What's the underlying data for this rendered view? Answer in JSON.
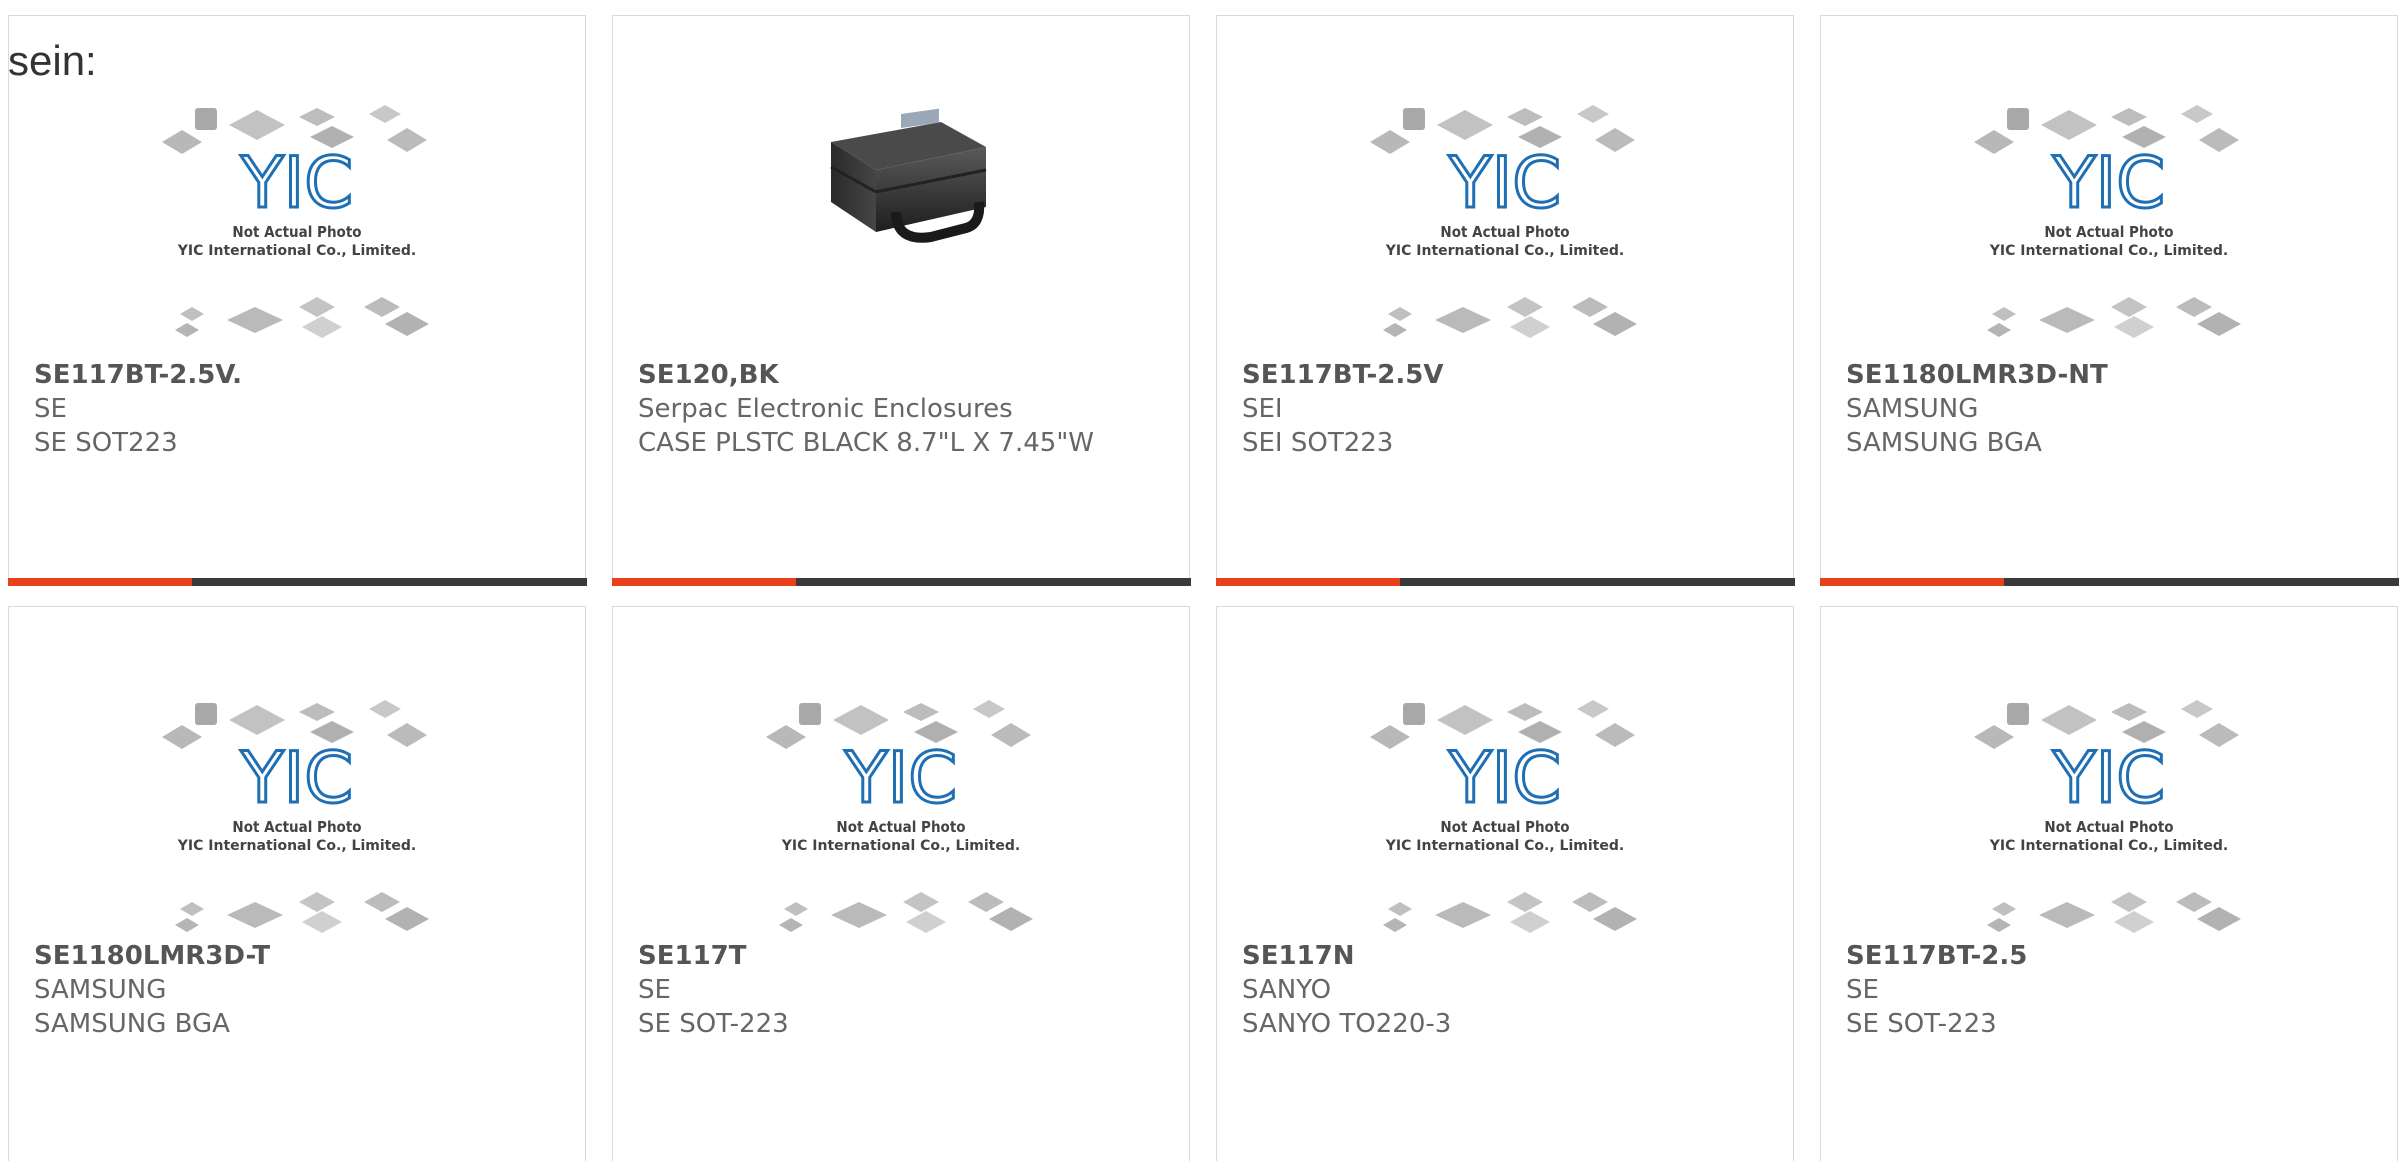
{
  "intro_text": "sein:",
  "placeholder": {
    "line1": "Not Actual Photo",
    "line2": "YIC International Co., Limited."
  },
  "products": [
    {
      "part": "SE117BT-2.5V.",
      "brand": "SE",
      "description": "SE SOT223",
      "image": "placeholder"
    },
    {
      "part": "SE120,BK",
      "brand": "Serpac Electronic Enclosures",
      "description": "CASE PLSTC BLACK 8.7\"L X 7.45\"W",
      "image": "black-case-photo"
    },
    {
      "part": "SE117BT-2.5V",
      "brand": "SEI",
      "description": "SEI SOT223",
      "image": "placeholder"
    },
    {
      "part": "SE1180LMR3D-NT",
      "brand": "SAMSUNG",
      "description": "SAMSUNG BGA",
      "image": "placeholder"
    },
    {
      "part": "SE1180LMR3D-T",
      "brand": "SAMSUNG",
      "description": "SAMSUNG BGA",
      "image": "placeholder"
    },
    {
      "part": "SE117T",
      "brand": "SE",
      "description": "SE SOT-223",
      "image": "placeholder"
    },
    {
      "part": "SE117N",
      "brand": "SANYO",
      "description": "SANYO TO220-3",
      "image": "placeholder"
    },
    {
      "part": "SE117BT-2.5",
      "brand": "SE",
      "description": "SE SOT-223",
      "image": "placeholder"
    }
  ],
  "colors": {
    "accent": "#e8401c",
    "bar": "#3a3a3a",
    "logo_blue": "#1f6fb5",
    "text": "#666666"
  }
}
